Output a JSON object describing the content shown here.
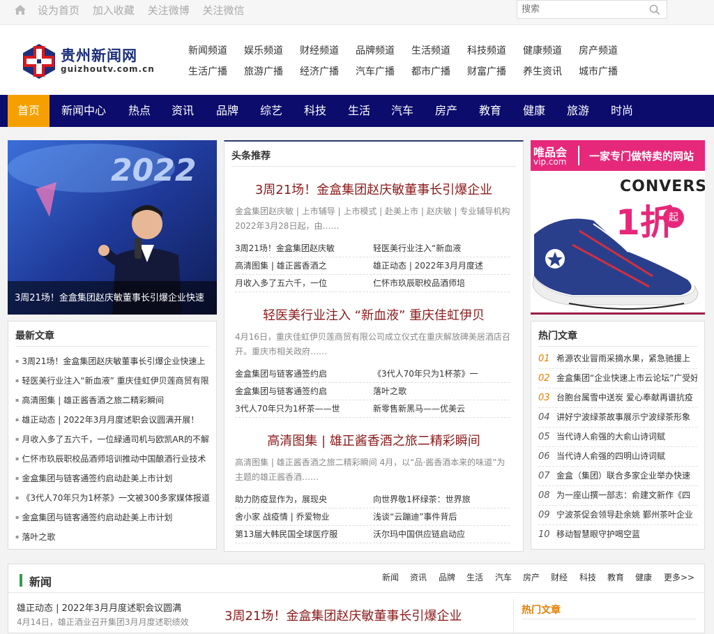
{
  "topbar": {
    "links": [
      "设为首页",
      "加入收藏",
      "关注微博",
      "关注微信"
    ],
    "search_placeholder": "搜索"
  },
  "logo": {
    "title": "贵州新闻网",
    "subtitle": "guizhoutv.com.cn"
  },
  "channels_row1": [
    "新闻频道",
    "娱乐频道",
    "财经频道",
    "品牌频道",
    "生活频道",
    "科技频道",
    "健康频道",
    "房产频道"
  ],
  "channels_row2": [
    "生活广播",
    "旅游广播",
    "经济广播",
    "汽车广播",
    "都市广播",
    "财富广播",
    "养生资讯",
    "城市广播"
  ],
  "nav": [
    "首页",
    "新闻中心",
    "热点",
    "资讯",
    "品牌",
    "综艺",
    "科技",
    "生活",
    "汽车",
    "房产",
    "教育",
    "健康",
    "旅游",
    "时尚"
  ],
  "featured": {
    "banner_text": "2022",
    "caption": "3周21场！金盒集团赵庆敏董事长引爆企业快速"
  },
  "latest": {
    "title": "最新文章",
    "items": [
      "3周21场！金盒集团赵庆敏董事长引爆企业快速上",
      "轻医美行业注入“新血液” 重庆佳虹伊贝莲商贸有限",
      "高清图集 | 雄正酱香酒之旅二精彩瞬间",
      "雄正动态 | 2022年3月月度述职会议圆满开展！",
      "月收入多了五六千，一位緑通司机与欧凯AR的不解",
      "仁怀市玖辰职校品酒师培训推动中国酿酒行业技术",
      "金盒集团与链客通签约启动赴美上市计划",
      "《3代人70年只为1杯茶》一文被300多家媒体报道",
      "金盒集团与链客通签约启动赴美上市计划",
      "落叶之歌"
    ]
  },
  "headlines": {
    "title": "头条推荐",
    "blocks": [
      {
        "title": "3周21场！金盒集团赵庆敏董事长引爆企业",
        "desc": "金盒集团赵庆敏 | 上市辅导 | 上市模式 | 赴美上市 | 赵庆敏 | 专业辅导机构 2022年3月28日起，由……",
        "links": [
          "3周21场！金盒集团赵庆敏",
          "轻医美行业注入“新血液",
          "高清图集 | 雄正酱香酒之",
          "雄正动态 | 2022年3月月度述",
          "月收入多了五六千，一位",
          "仁怀市玖辰职校品酒师培"
        ]
      },
      {
        "title": "轻医美行业注入 “新血液” 重庆佳虹伊贝",
        "desc": "4月16日，重庆佳虹伊贝莲商贸有限公司成立仪式在重庆解放碑美居酒店召开。重庆市相关政府……",
        "links": [
          "金盒集团与链客通签约启",
          "《3代人70年只为1杯茶》一",
          "金盒集团与链客通签约启",
          "落叶之歌",
          "3代人70年只为1杯茶——世",
          "新零售新黑马——优美云"
        ]
      },
      {
        "title": "高清图集 | 雄正酱香酒之旅二精彩瞬间",
        "desc": "高清图集 | 雄正酱香酒之旅二精彩瞬间 4月，以“品·酱香酒本来的味道”为主题的雄正酱香酒……",
        "links": [
          "助力防疫显作为，展现央",
          "向世界敬1杯绿茶：世界旅",
          "舍小家 战疫情 | 乔爱物业",
          "浅谈“云蹦迪”事件背后",
          "第13届大韩民国全球医疗服",
          "沃尔玛中国供应链启动应"
        ]
      }
    ]
  },
  "ad": {
    "brand": "唯品会",
    "brand_url": "vip.com",
    "slogan": "一家专门做特卖的网站",
    "product": "CONVERSE",
    "discount": "1折",
    "discount_suffix": "起"
  },
  "hot": {
    "title": "热门文章",
    "items": [
      {
        "num": "01",
        "text": "希源农业冒雨采摘水果，紧急驰援上"
      },
      {
        "num": "02",
        "text": "金盒集团“企业快速上市云论坛”广受好"
      },
      {
        "num": "03",
        "text": "台胞台属雪中送炭 爱心奉献再谱抗疫"
      },
      {
        "num": "04",
        "text": "讲好宁波绿茶故事展示宁波绿茶形象"
      },
      {
        "num": "05",
        "text": "当代诗人俞强的大俞山诗词赋"
      },
      {
        "num": "06",
        "text": "当代诗人俞强的四明山诗词赋"
      },
      {
        "num": "07",
        "text": "金盒（集团）联合多家企业举办快速"
      },
      {
        "num": "08",
        "text": "为一座山撰一部志：俞建文新作《四"
      },
      {
        "num": "09",
        "text": "宁波茶促会领导赴余姚 鄞州茶叶企业"
      },
      {
        "num": "10",
        "text": "移动智慧眼守护喝空蓝"
      }
    ]
  },
  "news_section": {
    "title": "新闻",
    "sublinks": [
      "新闻",
      "资讯",
      "品牌",
      "生活",
      "汽车",
      "房产",
      "财经",
      "科技",
      "教育",
      "健康",
      "更多>>"
    ],
    "left_title": "雄正动态 | 2022年3月月度述职会议圆满",
    "left_desc": "4月14日，雄正酒业召开集团3月月度述职绩效",
    "center_title": "3周21场！金盒集团赵庆敏董事长引爆企业",
    "right_title": "热门文章"
  },
  "colors": {
    "nav": "#0b0c6c",
    "accent": "#f5a000",
    "headline": "#8b1a1a",
    "hot_top": "#e67e00",
    "news_bar": "#2e9e4a",
    "ad_pink": "#e6287a"
  }
}
